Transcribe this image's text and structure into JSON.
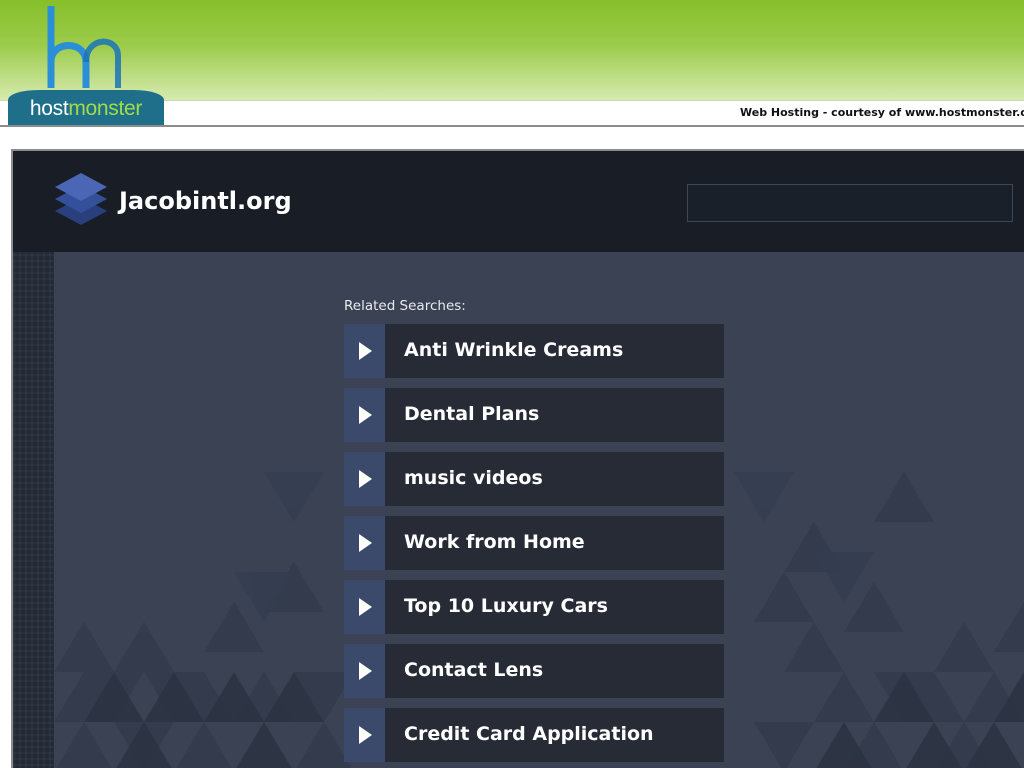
{
  "banner": {
    "logo_host": "host",
    "logo_monster": "monster",
    "courtesy_text": "Web Hosting - courtesy of www.hostmonster.com",
    "logo_icon": "hm-logo-icon"
  },
  "header": {
    "site_name": "Jacobintl.org",
    "logo_icon": "stacked-layers-icon",
    "search": {
      "value": "",
      "placeholder": ""
    }
  },
  "related": {
    "label": "Related Searches:",
    "arrow_icon": "play-arrow-icon",
    "items": [
      {
        "label": "Anti Wrinkle Creams"
      },
      {
        "label": "Dental Plans"
      },
      {
        "label": "music videos"
      },
      {
        "label": "Work from Home"
      },
      {
        "label": "Top 10 Luxury Cars"
      },
      {
        "label": "Contact Lens"
      },
      {
        "label": "Credit Card Application"
      }
    ]
  },
  "colors": {
    "banner_green": "#86bf2a",
    "header_bg": "#181d26",
    "content_bg": "#3a4254",
    "item_bg": "#262b36",
    "arrow_bg": "#3b4a6b"
  }
}
